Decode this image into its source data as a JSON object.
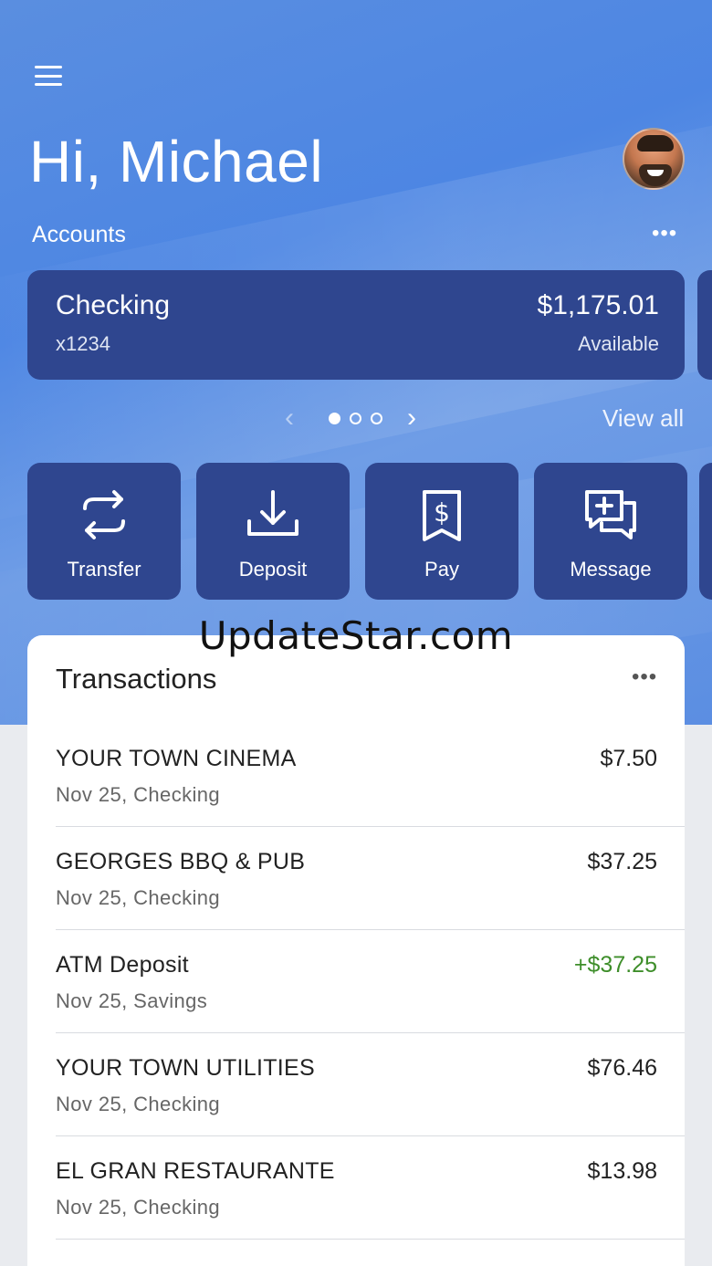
{
  "header": {
    "greeting": "Hi, Michael",
    "accounts_label": "Accounts",
    "more_glyph": "•••"
  },
  "account": {
    "name": "Checking",
    "number": "x1234",
    "balance": "$1,175.01",
    "balance_caption": "Available"
  },
  "carousel": {
    "prev_glyph": "‹",
    "next_glyph": "›",
    "view_all": "View all",
    "active_page": 1,
    "page_count": 3
  },
  "actions": [
    {
      "label": "Transfer",
      "icon": "transfer-arrows-icon"
    },
    {
      "label": "Deposit",
      "icon": "download-tray-icon"
    },
    {
      "label": "Pay",
      "icon": "dollar-receipt-icon"
    },
    {
      "label": "Message",
      "icon": "message-plus-icon"
    }
  ],
  "transactions": {
    "title": "Transactions",
    "more_glyph": "•••",
    "items": [
      {
        "name": "YOUR TOWN CINEMA",
        "meta": "Nov 25, Checking",
        "amount": "$7.50",
        "credit": false
      },
      {
        "name": "GEORGES BBQ & PUB",
        "meta": "Nov 25, Checking",
        "amount": "$37.25",
        "credit": false
      },
      {
        "name": "ATM Deposit",
        "meta": "Nov 25, Savings",
        "amount": "+$37.25",
        "credit": true
      },
      {
        "name": "YOUR TOWN UTILITIES",
        "meta": "Nov 25, Checking",
        "amount": "$76.46",
        "credit": false
      },
      {
        "name": "EL GRAN RESTAURANTE",
        "meta": "Nov 25, Checking",
        "amount": "$13.98",
        "credit": false
      }
    ]
  },
  "watermark": "UpdateStar.com",
  "colors": {
    "hero_blue": "#5a8ee0",
    "card_navy": "#2f468f",
    "credit_green": "#3e8e2a"
  }
}
